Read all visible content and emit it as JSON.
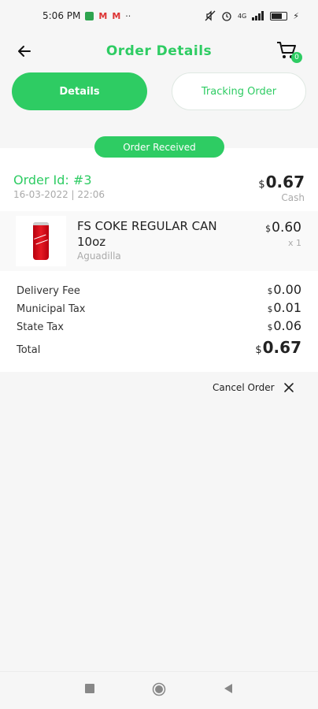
{
  "status_bar": {
    "time": "5:06 PM",
    "icons": [
      "whatsapp-icon",
      "gmail-icon",
      "gmail-icon",
      "more-dots-icon"
    ],
    "right_icons": [
      "mute-icon",
      "alarm-icon",
      "signal-icon",
      "battery-icon"
    ],
    "signal_label": "4G"
  },
  "header": {
    "title": "Order Details",
    "cart_count": "0"
  },
  "tabs": [
    {
      "label": "Details",
      "active": true
    },
    {
      "label": "Tracking Order",
      "active": false
    }
  ],
  "order": {
    "status": "Order Received",
    "id_label": "Order Id: #3",
    "date": "16-03-2022 | 22:06",
    "currency": "$",
    "total": "0.67",
    "payment_method": "Cash"
  },
  "items": [
    {
      "name": "FS COKE REGULAR CAN 10oz",
      "store": "Aguadilla",
      "price": "0.60",
      "qty": "x 1"
    }
  ],
  "fees": [
    {
      "label": "Delivery Fee",
      "value": "0.00"
    },
    {
      "label": "Municipal Tax",
      "value": "0.01"
    },
    {
      "label": "State Tax",
      "value": "0.06"
    }
  ],
  "total": {
    "label": "Total",
    "value": "0.67"
  },
  "cancel_label": "Cancel Order",
  "colors": {
    "accent": "#2ecc63",
    "muted": "#aaaaaa"
  }
}
